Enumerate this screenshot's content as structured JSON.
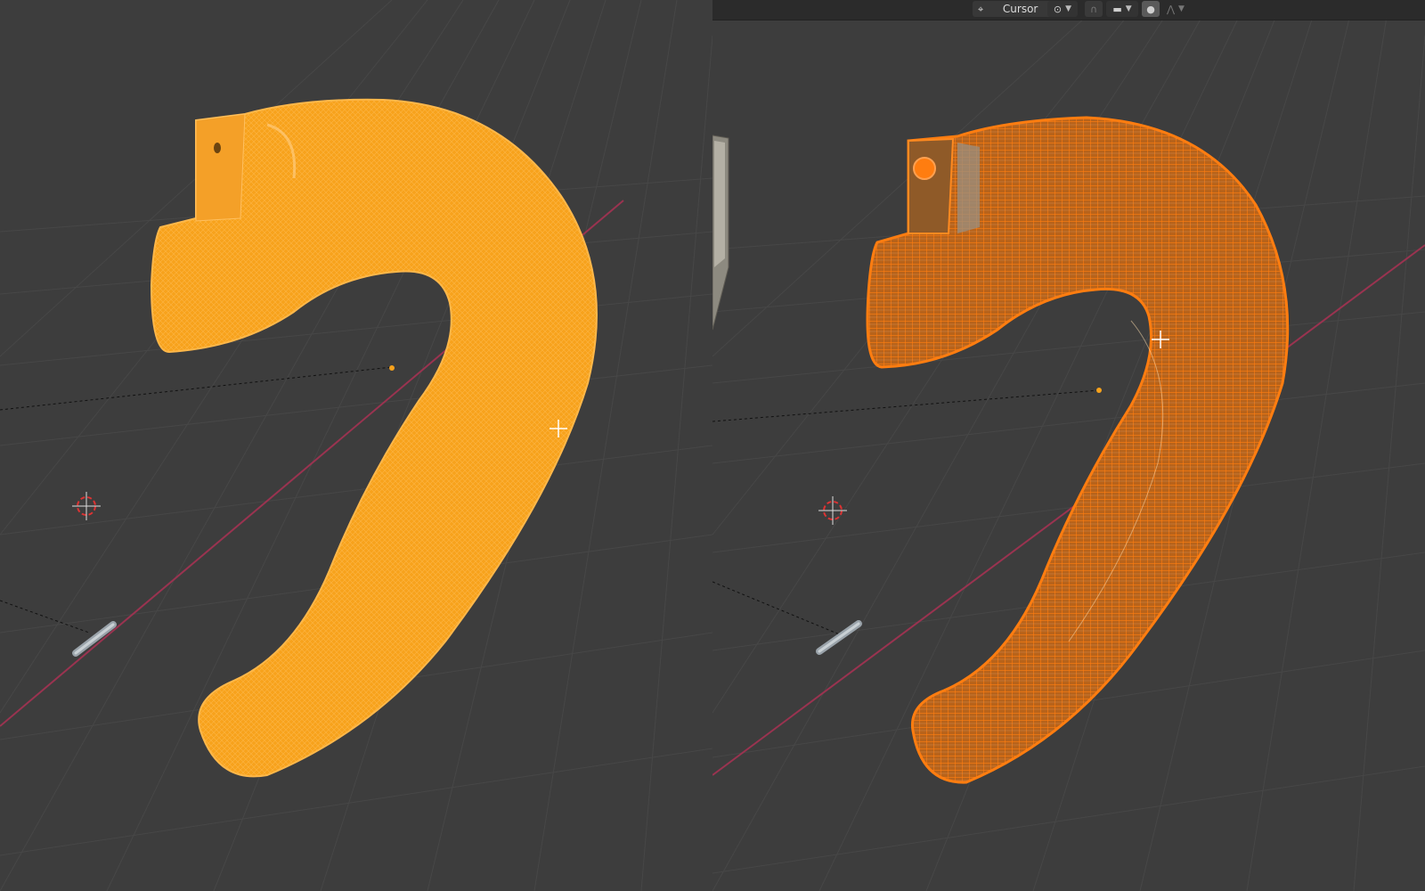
{
  "header": {
    "pivot_dropdown": {
      "icon": "pivot-icon",
      "label": "Cursor"
    },
    "snap_dropdown": {
      "icon": "snap-target-icon"
    },
    "snap_toggle": {
      "icon": "magnet-icon"
    },
    "snap_element_dropdown": {
      "icon": "increment-icon"
    },
    "proportional_toggle": {
      "icon": "proportional-editing-icon"
    },
    "proportional_falloff": {
      "icon": "falloff-curve-icon"
    }
  },
  "viewports": [
    {
      "name": "left",
      "mesh_color": "#f7a21c",
      "wire_color": "#ffb84a"
    },
    {
      "name": "right",
      "mesh_color": "#b8631a",
      "wire_color": "#ff7d10"
    }
  ],
  "colors": {
    "background": "#3d3d3d",
    "grid": "#474747",
    "x_axis": "#9a3350",
    "selection_orange": "#ff8c12"
  }
}
